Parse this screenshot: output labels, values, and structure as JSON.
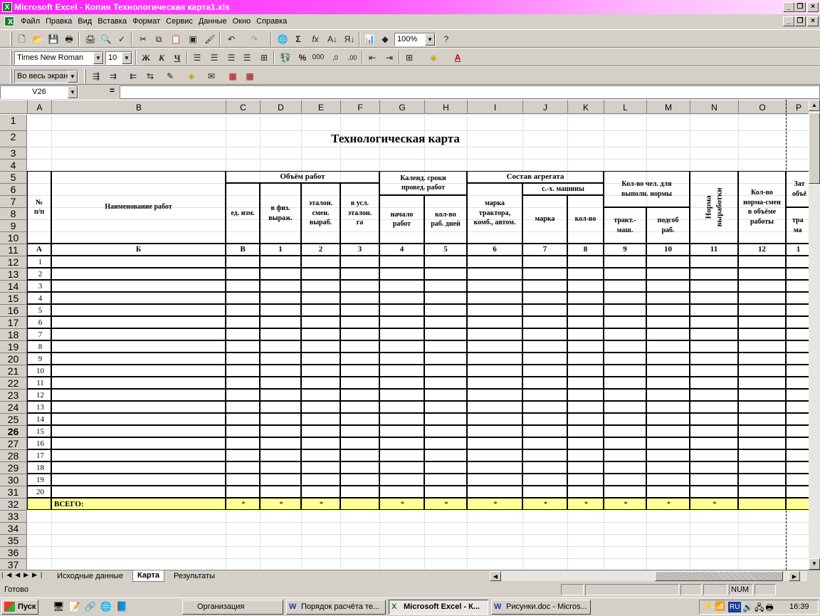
{
  "window": {
    "title": "Microsoft Excel - Копия Технологическая карта1.xls",
    "icon": "excel-icon"
  },
  "menu": [
    "Файл",
    "Правка",
    "Вид",
    "Вставка",
    "Формат",
    "Сервис",
    "Данные",
    "Окно",
    "Справка"
  ],
  "toolbar": {
    "zoom": "100%",
    "font": "Times New Roman",
    "font_size": "10",
    "view_mode": "Во весь экран"
  },
  "formula_bar": {
    "name_box": "V26",
    "eq": "="
  },
  "columns": [
    "A",
    "B",
    "C",
    "D",
    "E",
    "F",
    "G",
    "H",
    "I",
    "J",
    "K",
    "L",
    "M",
    "N",
    "O",
    "P"
  ],
  "sheet": {
    "title": "Технологическая карта",
    "h_no": "№\nп/п",
    "h_name": "Наименование работ",
    "h_volume": "Объём работ",
    "h_unit": "ед. изм.",
    "h_phys": "в физ.\nвыраж.",
    "h_etalon": "эталон.\nсмен.\nвыраб.",
    "h_usl": "в усл.\nэталон.\nга",
    "h_calendar": "Календ. сроки\nпровед. работ",
    "h_start": "начало\nработ",
    "h_days": "кол-во\nраб. дней",
    "h_unit_comp": "Состав агрегата",
    "h_tractor": "марка\nтрактора,\nкомб., автом.",
    "h_agri": "с.-х. машины",
    "h_mark": "марка",
    "h_count": "кол-во",
    "h_people": "Кол-во чел. для\nвыполн. нормы",
    "h_tract_m": "тракт.-\nмаш.",
    "h_aux": "подсоб\nраб.",
    "h_norm": "Норма\nвыработки",
    "h_normsm": "Кол-во\nнорма-смен\nв объёме\nработы",
    "h_zat": "Зат\nобъё",
    "h_tra": "тра\nма",
    "codes": [
      "А",
      "Б",
      "В",
      "1",
      "2",
      "3",
      "4",
      "5",
      "6",
      "7",
      "8",
      "9",
      "10",
      "11",
      "12",
      "1"
    ],
    "rows": [
      "1",
      "2",
      "3",
      "4",
      "5",
      "6",
      "7",
      "8",
      "9",
      "10",
      "11",
      "12",
      "13",
      "14",
      "15",
      "16",
      "17",
      "18",
      "19",
      "20"
    ],
    "total": "ВСЕГО:",
    "star": "*"
  },
  "row_numbers": [
    "1",
    "2",
    "3",
    "4",
    "5",
    "6",
    "7",
    "8",
    "9",
    "10",
    "11",
    "12",
    "13",
    "14",
    "15",
    "16",
    "17",
    "18",
    "19",
    "20",
    "21",
    "22",
    "23",
    "24",
    "25",
    "26",
    "27",
    "28",
    "29",
    "30",
    "31",
    "32",
    "33",
    "34",
    "35",
    "36",
    "37"
  ],
  "tabs": [
    "Исходные данные",
    "Карта",
    "Результаты"
  ],
  "status": {
    "ready": "Готово",
    "num": "NUM"
  },
  "taskbar": {
    "start": "Пуск",
    "tasks": [
      "Организация",
      "Порядок расчёта те...",
      "Microsoft Excel - К...",
      "Рисунки.doc - Micros..."
    ],
    "lang": "RU",
    "clock": "16:39"
  }
}
